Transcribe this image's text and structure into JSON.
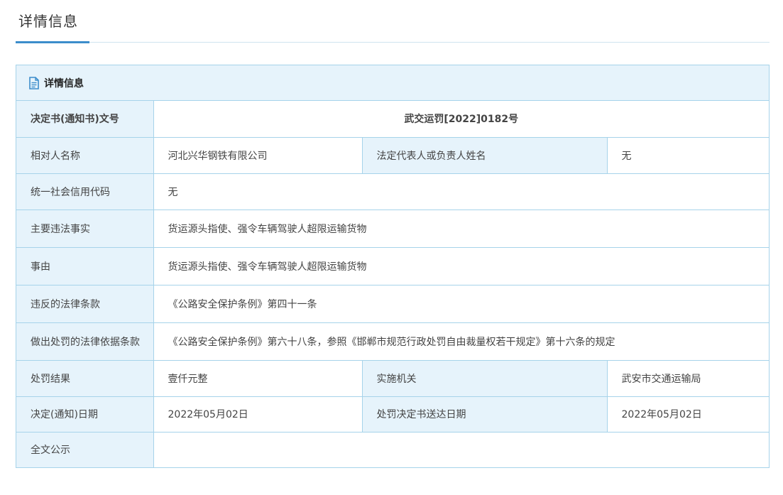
{
  "page_title": "详情信息",
  "panel": {
    "title": "详情信息",
    "icon": "document-icon"
  },
  "rows": {
    "decision_no": {
      "label": "决定书(通知书)文号",
      "value": "武交运罚[2022]0182号"
    },
    "counterparty": {
      "label": "相对人名称",
      "value": "河北兴华钢铁有限公司",
      "label2": "法定代表人或负责人姓名",
      "value2": "无"
    },
    "credit_code": {
      "label": "统一社会信用代码",
      "value": "无"
    },
    "main_facts": {
      "label": "主要违法事实",
      "value": "货运源头指使、强令车辆驾驶人超限运输货物"
    },
    "cause": {
      "label": "事由",
      "value": "货运源头指使、强令车辆驾驶人超限运输货物"
    },
    "violated_law": {
      "label": "违反的法律条款",
      "value": "《公路安全保护条例》第四十一条"
    },
    "penalty_basis": {
      "label": "做出处罚的法律依据条款",
      "value": "《公路安全保护条例》第六十八条，参照《邯郸市规范行政处罚自由裁量权若干规定》第十六条的规定"
    },
    "result": {
      "label": "处罚结果",
      "value": "壹仟元整",
      "label2": "实施机关",
      "value2": "武安市交通运输局"
    },
    "date": {
      "label": "决定(通知)日期",
      "value": "2022年05月02日",
      "label2": "处罚决定书送达日期",
      "value2": "2022年05月02日"
    },
    "full_text": {
      "label": "全文公示",
      "value": ""
    }
  },
  "colors": {
    "accent": "#3c8dcb",
    "border": "#a6d3ea",
    "label_bg": "#e6f3fb"
  }
}
